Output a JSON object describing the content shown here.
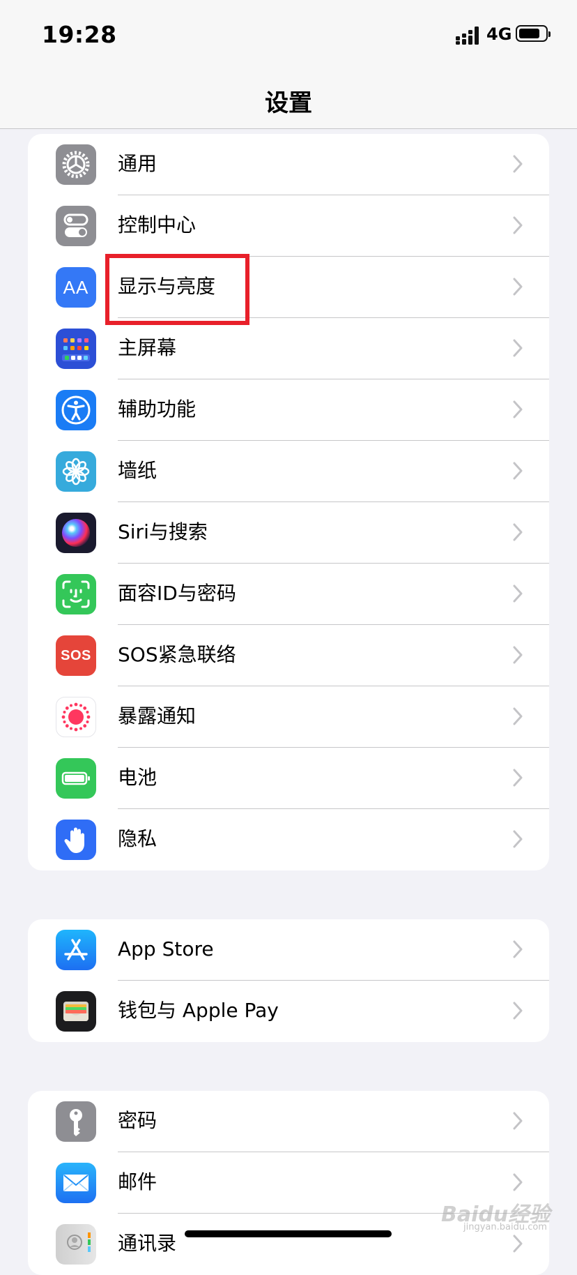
{
  "status": {
    "time": "19:28",
    "network": "4G"
  },
  "nav": {
    "title": "设置"
  },
  "groups": [
    [
      {
        "label": "通用",
        "icon": "gear-icon",
        "color": "#8e8e93"
      },
      {
        "label": "控制中心",
        "icon": "toggles-icon",
        "color": "#8e8e93"
      },
      {
        "label": "显示与亮度",
        "icon": "text-size-icon",
        "color": "#3478f6"
      },
      {
        "label": "主屏幕",
        "icon": "home-grid-icon",
        "color": "#2c4fd6"
      },
      {
        "label": "辅助功能",
        "icon": "accessibility-icon",
        "color": "#1a7cf5"
      },
      {
        "label": "墙纸",
        "icon": "flower-icon",
        "color": "#36aadc"
      },
      {
        "label": "Siri与搜索",
        "icon": "siri-icon",
        "color": "#1a1a2e"
      },
      {
        "label": "面容ID与密码",
        "icon": "face-id-icon",
        "color": "#34c759"
      },
      {
        "label": "SOS紧急联络",
        "icon": "sos-icon",
        "color": "#e5453a"
      },
      {
        "label": "暴露通知",
        "icon": "exposure-icon",
        "color": "#ffffff"
      },
      {
        "label": "电池",
        "icon": "battery-icon",
        "color": "#34c759"
      },
      {
        "label": "隐私",
        "icon": "hand-icon",
        "color": "#2f6df6"
      }
    ],
    [
      {
        "label": "App Store",
        "icon": "app-store-icon",
        "color": "#1d8ff7"
      },
      {
        "label": "钱包与 Apple Pay",
        "icon": "wallet-icon",
        "color": "#1c1c1e"
      }
    ],
    [
      {
        "label": "密码",
        "icon": "key-icon",
        "color": "#8e8e93"
      },
      {
        "label": "邮件",
        "icon": "mail-icon",
        "color": "#1d8ff7"
      },
      {
        "label": "通讯录",
        "icon": "contacts-icon",
        "color": "#d8d8d8"
      }
    ]
  ],
  "watermark": {
    "brand": "Baidu经验",
    "url": "jingyan.baidu.com"
  },
  "icon_texts": {
    "display": "AA",
    "sos": "SOS"
  },
  "colors": {
    "highlight_box": "#e8202a",
    "background": "#f2f2f7"
  }
}
